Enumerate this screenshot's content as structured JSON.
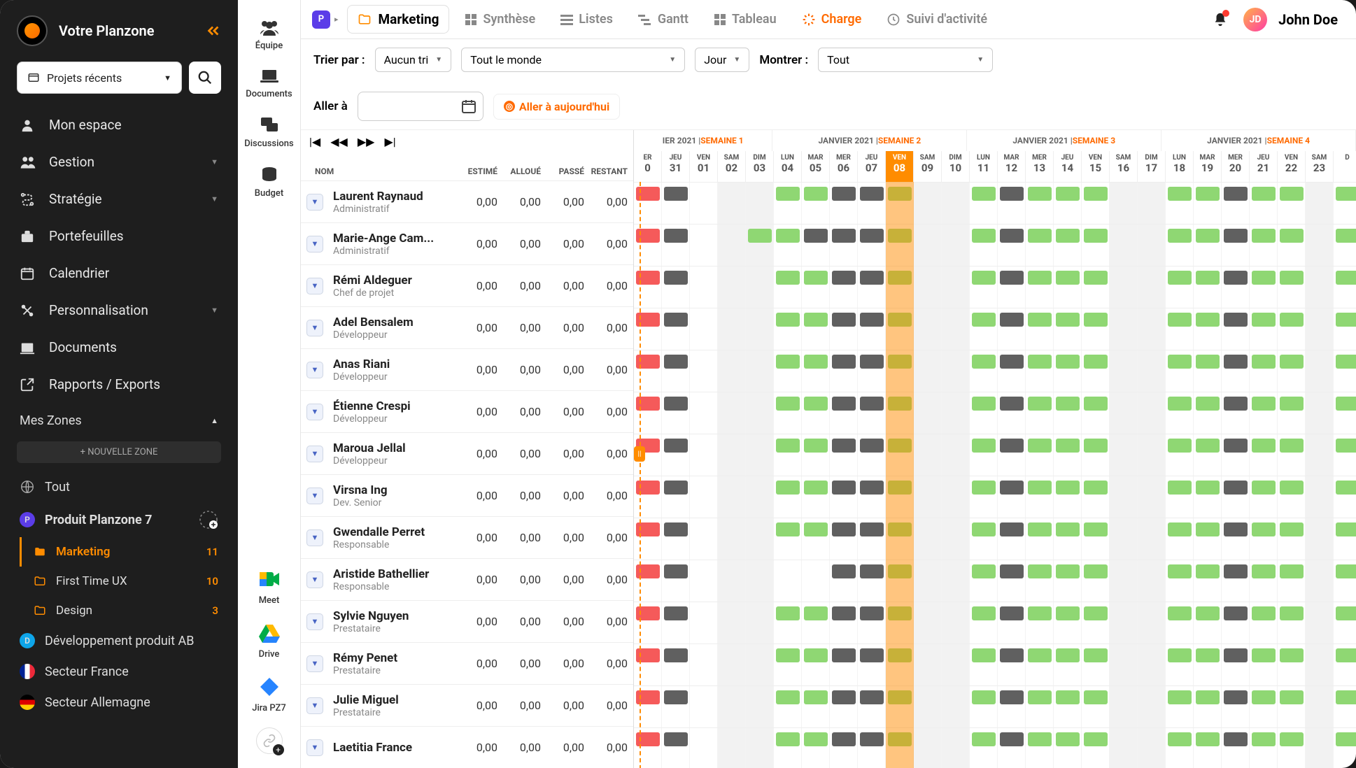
{
  "brand": "Votre Planzone",
  "recent_projects_label": "Projets récents",
  "nav": [
    {
      "icon": "user",
      "label": "Mon espace"
    },
    {
      "icon": "users",
      "label": "Gestion",
      "caret": true
    },
    {
      "icon": "route",
      "label": "Stratégie",
      "caret": true
    },
    {
      "icon": "briefcase",
      "label": "Portefeuilles"
    },
    {
      "icon": "calendar",
      "label": "Calendrier"
    },
    {
      "icon": "wrench",
      "label": "Personnalisation",
      "caret": true
    },
    {
      "icon": "doc",
      "label": "Documents"
    },
    {
      "icon": "export",
      "label": "Rapports / Exports"
    }
  ],
  "zones_header": "Mes Zones",
  "new_zone": "+ NOUVELLE ZONE",
  "zones": {
    "tout": "Tout",
    "produit": "Produit Planzone 7",
    "marketing": {
      "label": "Marketing",
      "count": "11"
    },
    "firsttime": {
      "label": "First Time UX",
      "count": "10"
    },
    "design": {
      "label": "Design",
      "count": "3"
    },
    "dev": "Développement produit AB",
    "france": "Secteur France",
    "allemagne": "Secteur Allemagne"
  },
  "subside": [
    {
      "label": "Équipe"
    },
    {
      "label": "Documents"
    },
    {
      "label": "Discussions"
    },
    {
      "label": "Budget"
    }
  ],
  "apps": [
    {
      "label": "Meet"
    },
    {
      "label": "Drive"
    },
    {
      "label": "Jira PZ7"
    }
  ],
  "breadcrumb": "Marketing",
  "tabs": [
    {
      "label": "Synthèse"
    },
    {
      "label": "Listes"
    },
    {
      "label": "Gantt"
    },
    {
      "label": "Tableau"
    },
    {
      "label": "Charge",
      "active": true
    },
    {
      "label": "Suivi d'activité"
    }
  ],
  "user": {
    "initials": "JD",
    "name": "John Doe"
  },
  "filters": {
    "sort_label": "Trier par :",
    "sort_value": "Aucun tri",
    "who_value": "Tout le monde",
    "period_value": "Jour",
    "show_label": "Montrer :",
    "show_value": "Tout",
    "goto_label": "Aller à",
    "today_label": "Aller à aujourd'hui"
  },
  "columns": {
    "nom": "NOM",
    "estime": "ESTIMÉ",
    "alloue": "ALLOUÉ",
    "passe": "PASSÉ",
    "restant": "RESTANT"
  },
  "people": [
    {
      "name": "Laurent Raynaud",
      "role": "Administratif",
      "e": "0,00",
      "a": "0,00",
      "p": "0,00",
      "r": "0,00"
    },
    {
      "name": "Marie-Ange Cam...",
      "role": "Administratif",
      "e": "0,00",
      "a": "0,00",
      "p": "0,00",
      "r": "0,00"
    },
    {
      "name": "Rémi Aldeguer",
      "role": "Chef de projet",
      "e": "0,00",
      "a": "0,00",
      "p": "0,00",
      "r": "0,00"
    },
    {
      "name": "Adel Bensalem",
      "role": "Développeur",
      "e": "0,00",
      "a": "0,00",
      "p": "0,00",
      "r": "0,00"
    },
    {
      "name": "Anas Riani",
      "role": "Développeur",
      "e": "0,00",
      "a": "0,00",
      "p": "0,00",
      "r": "0,00"
    },
    {
      "name": "Étienne Crespi",
      "role": "Développeur",
      "e": "0,00",
      "a": "0,00",
      "p": "0,00",
      "r": "0,00"
    },
    {
      "name": "Maroua Jellal",
      "role": "Développeur",
      "e": "0,00",
      "a": "0,00",
      "p": "0,00",
      "r": "0,00"
    },
    {
      "name": "Virsna Ing",
      "role": "Dev. Senior",
      "e": "0,00",
      "a": "0,00",
      "p": "0,00",
      "r": "0,00"
    },
    {
      "name": "Gwendalle Perret",
      "role": "Responsable",
      "e": "0,00",
      "a": "0,00",
      "p": "0,00",
      "r": "0,00"
    },
    {
      "name": "Aristide Bathellier",
      "role": "Responsable",
      "e": "0,00",
      "a": "0,00",
      "p": "0,00",
      "r": "0,00"
    },
    {
      "name": "Sylvie Nguyen",
      "role": "Prestataire",
      "e": "0,00",
      "a": "0,00",
      "p": "0,00",
      "r": "0,00"
    },
    {
      "name": "Rémy Penet",
      "role": "Prestataire",
      "e": "0,00",
      "a": "0,00",
      "p": "0,00",
      "r": "0,00"
    },
    {
      "name": "Julie Miguel",
      "role": "Prestataire",
      "e": "0,00",
      "a": "0,00",
      "p": "0,00",
      "r": "0,00"
    },
    {
      "name": "Laetitia France",
      "role": "",
      "e": "0,00",
      "a": "0,00",
      "p": "0,00",
      "r": "0,00"
    }
  ],
  "timeline": {
    "month": "JANVIER 2021",
    "weeks": [
      "SEMAINE 1",
      "SEMAINE 2",
      "SEMAINE 3",
      "SEMAINE 4"
    ],
    "days": [
      {
        "dn": "ER",
        "dd": "0"
      },
      {
        "dn": "JEU",
        "dd": "31"
      },
      {
        "dn": "VEN",
        "dd": "01"
      },
      {
        "dn": "SAM",
        "dd": "02",
        "we": true
      },
      {
        "dn": "DIM",
        "dd": "03",
        "we": true
      },
      {
        "dn": "LUN",
        "dd": "04"
      },
      {
        "dn": "MAR",
        "dd": "05"
      },
      {
        "dn": "MER",
        "dd": "06"
      },
      {
        "dn": "JEU",
        "dd": "07"
      },
      {
        "dn": "VEN",
        "dd": "08",
        "today": true
      },
      {
        "dn": "SAM",
        "dd": "09",
        "we": true
      },
      {
        "dn": "DIM",
        "dd": "10",
        "we": true
      },
      {
        "dn": "LUN",
        "dd": "11"
      },
      {
        "dn": "MAR",
        "dd": "12"
      },
      {
        "dn": "MER",
        "dd": "13"
      },
      {
        "dn": "JEU",
        "dd": "14"
      },
      {
        "dn": "VEN",
        "dd": "15"
      },
      {
        "dn": "SAM",
        "dd": "16",
        "we": true
      },
      {
        "dn": "DIM",
        "dd": "17",
        "we": true
      },
      {
        "dn": "LUN",
        "dd": "18"
      },
      {
        "dn": "MAR",
        "dd": "19"
      },
      {
        "dn": "MER",
        "dd": "20"
      },
      {
        "dn": "JEU",
        "dd": "21"
      },
      {
        "dn": "VEN",
        "dd": "22"
      },
      {
        "dn": "SAM",
        "dd": "23",
        "we": true
      },
      {
        "dn": "D",
        "dd": ""
      }
    ],
    "bars_pattern": {
      "comment": "per-row bars: col index -> color; derived for all rows below"
    }
  }
}
